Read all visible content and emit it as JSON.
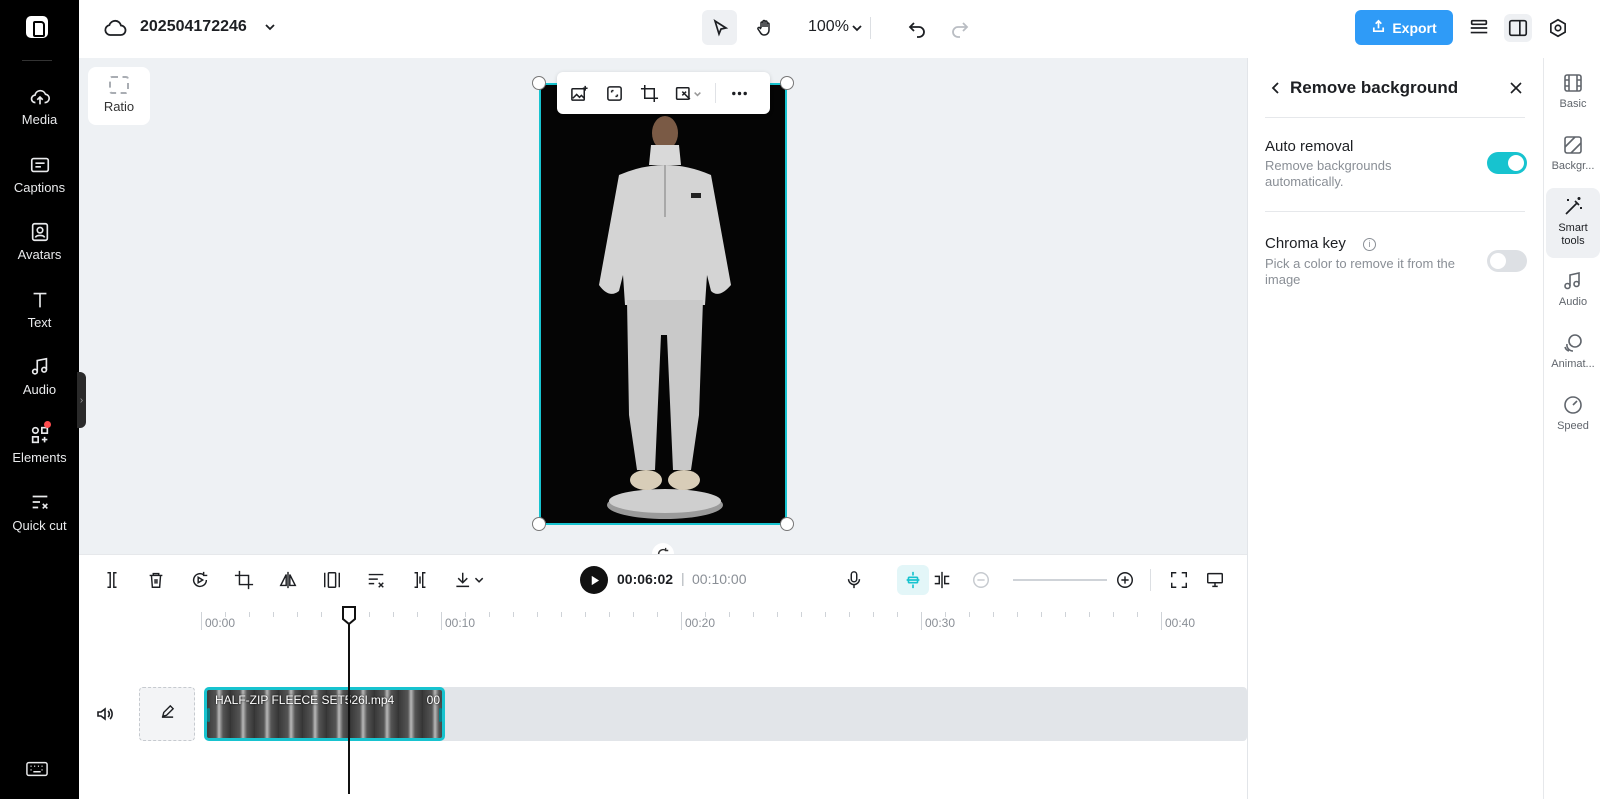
{
  "left_sidebar": {
    "items": [
      {
        "label": "Media",
        "icon": "cloud-upload-icon"
      },
      {
        "label": "Captions",
        "icon": "captions-icon"
      },
      {
        "label": "Avatars",
        "icon": "avatar-icon"
      },
      {
        "label": "Text",
        "icon": "text-icon"
      },
      {
        "label": "Audio",
        "icon": "music-note-icon"
      },
      {
        "label": "Elements",
        "icon": "elements-icon"
      },
      {
        "label": "Quick cut",
        "icon": "scissors-icon"
      }
    ],
    "bottom_icon": "keyboard-icon"
  },
  "topbar": {
    "project_name": "202504172246",
    "zoom": "100%",
    "export_label": "Export"
  },
  "canvas": {
    "ratio_label": "Ratio"
  },
  "remove_background": {
    "title": "Remove background",
    "auto_removal": {
      "label": "Auto removal",
      "description": "Remove backgrounds automatically.",
      "enabled": true
    },
    "chroma_key": {
      "label": "Chroma key",
      "description": "Pick a color to remove it from the image",
      "enabled": false
    }
  },
  "right_nav": {
    "items": [
      {
        "label": "Basic",
        "icon": "film-icon"
      },
      {
        "label": "Backgr...",
        "icon": "background-icon"
      },
      {
        "label": "Smart tools",
        "icon": "magic-wand-icon",
        "active": true
      },
      {
        "label": "Audio",
        "icon": "music-note-icon"
      },
      {
        "label": "Animat...",
        "icon": "animation-icon"
      },
      {
        "label": "Speed",
        "icon": "speedometer-icon"
      }
    ]
  },
  "playback": {
    "current_time": "00:06:02",
    "separator": "|",
    "total_time": "00:10:00"
  },
  "timeline": {
    "ruler": [
      "00:00",
      "00:10",
      "00:20",
      "00:30",
      "00:40"
    ],
    "clip": {
      "name": "HALF-ZIP FLEECE SET526l.mp4",
      "time": "00"
    }
  },
  "colors": {
    "accent": "#17c3cf",
    "export": "#2f9bf7",
    "sidebar_bg": "#000000",
    "notification": "#ff4d4f"
  }
}
